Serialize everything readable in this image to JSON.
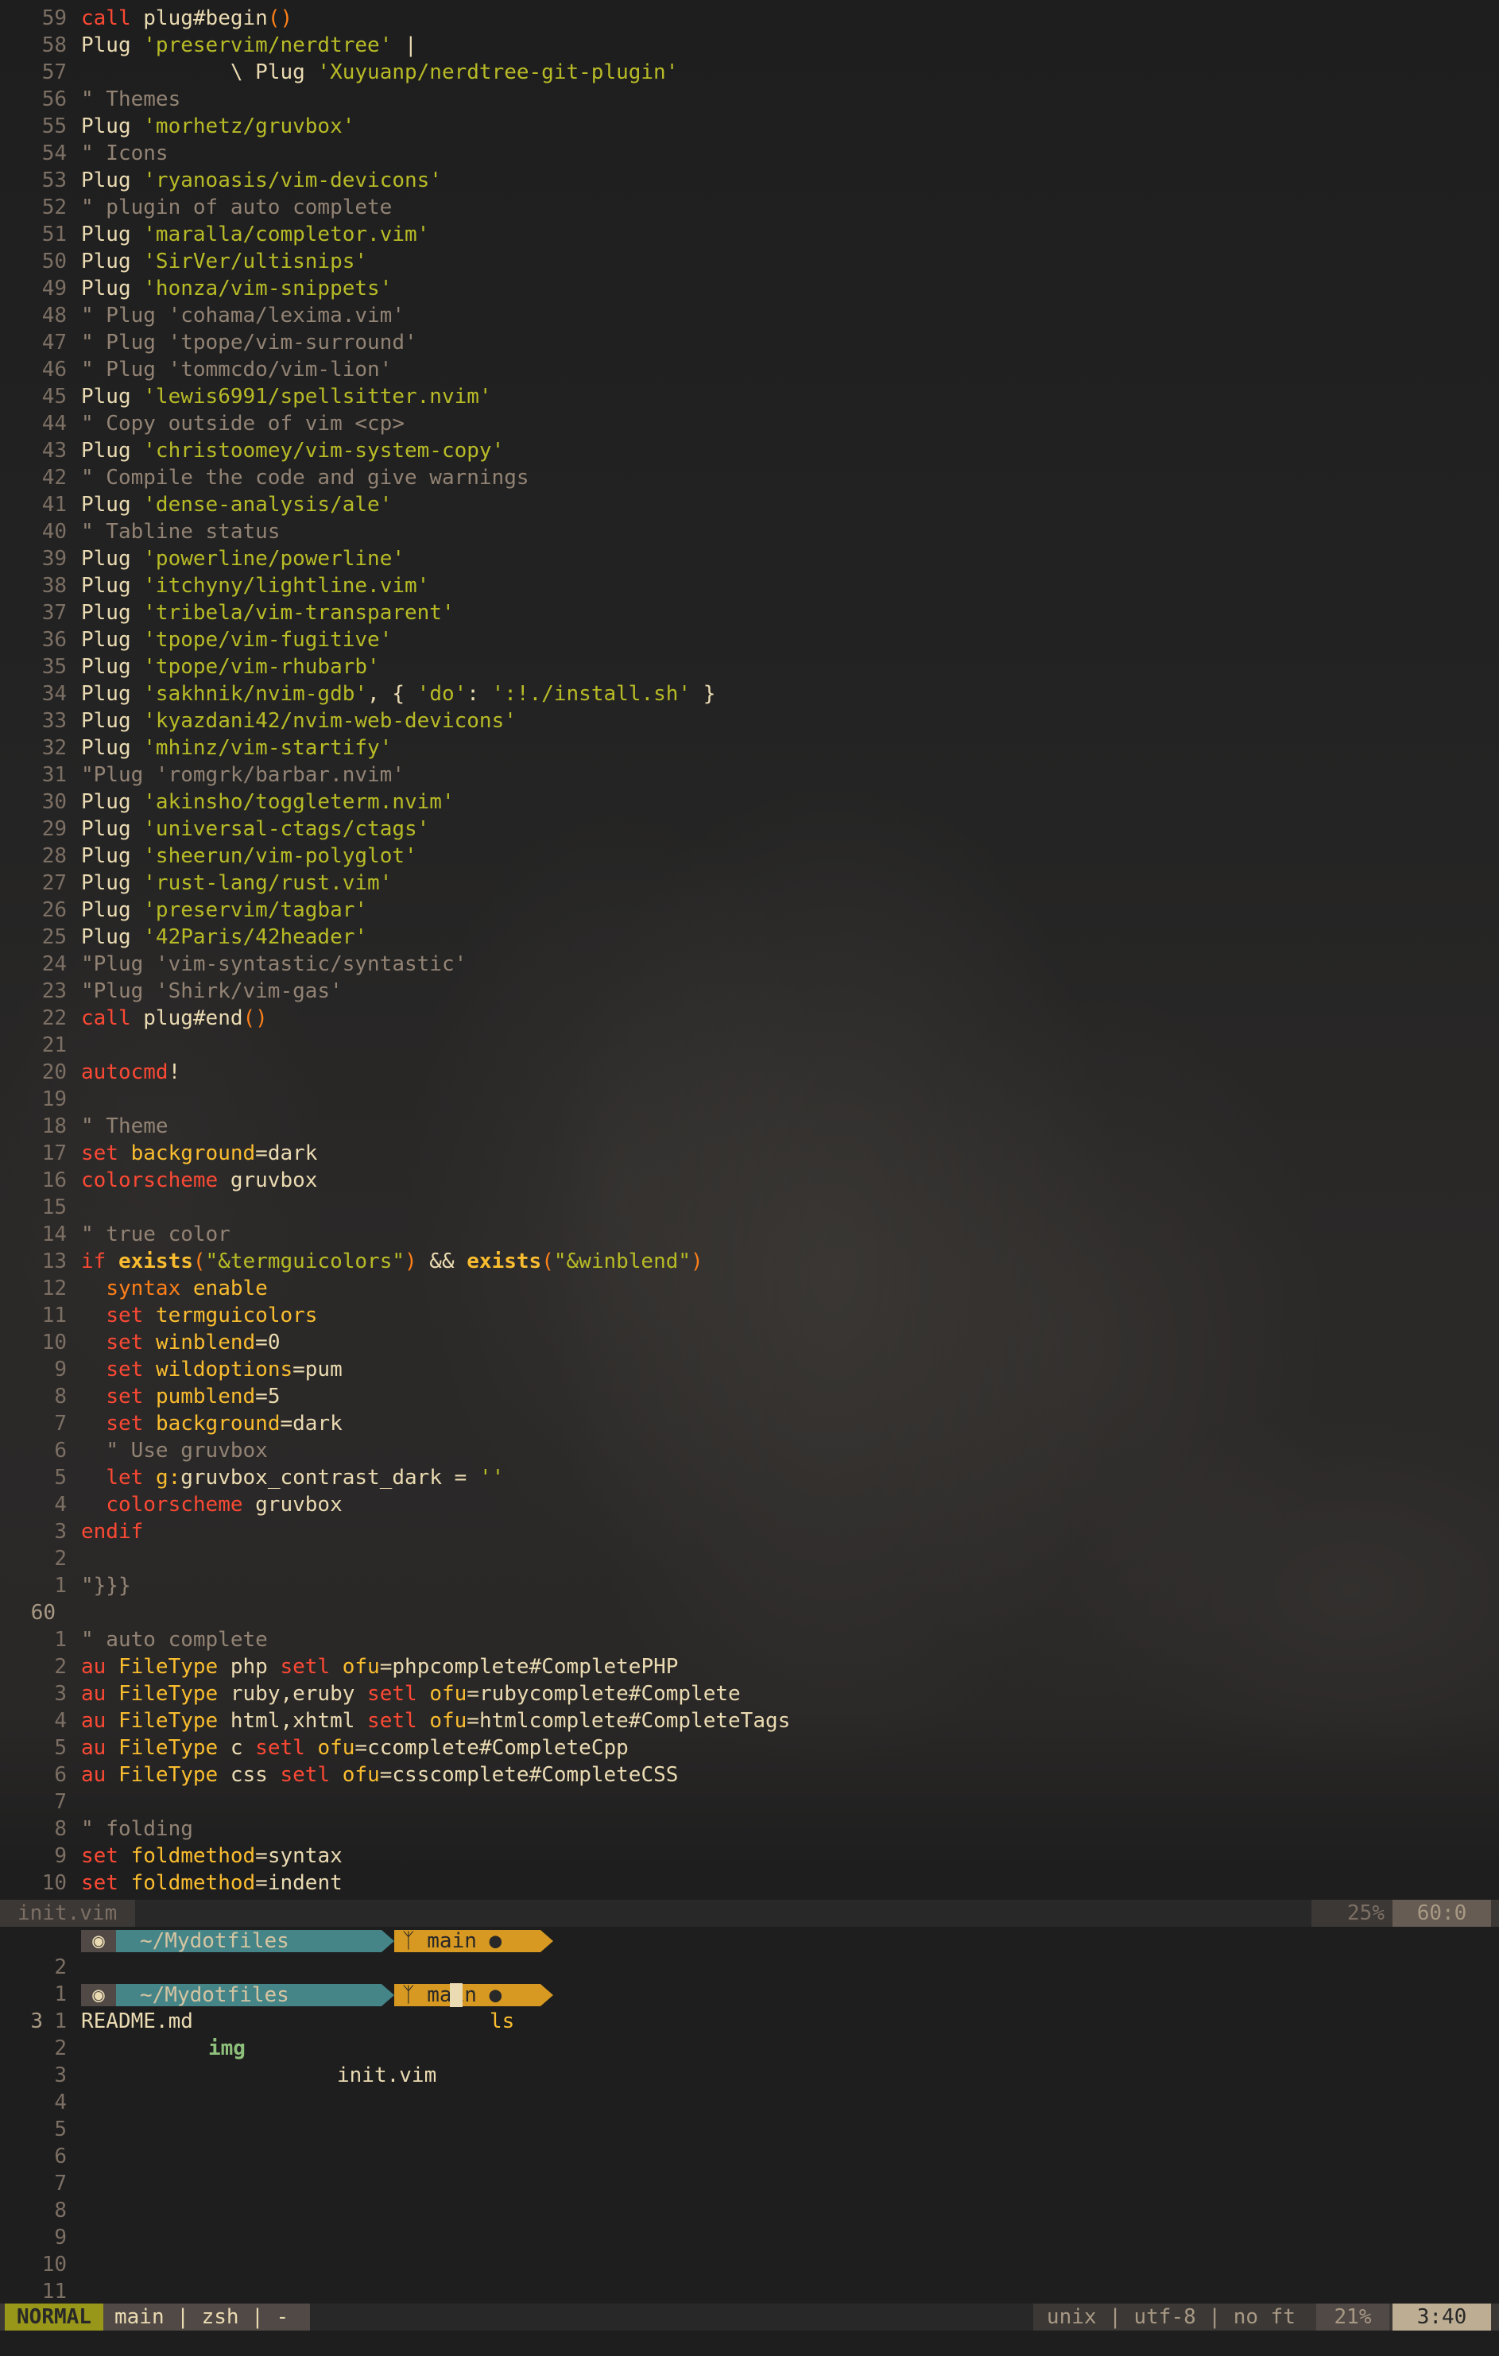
{
  "editor": {
    "lines": [
      {
        "n": "59",
        "tokens": [
          [
            "kw",
            "call"
          ],
          [
            "fg",
            " plug#begin"
          ],
          [
            "ora",
            "()"
          ]
        ]
      },
      {
        "n": "58",
        "tokens": [
          [
            "fg",
            "Plug "
          ],
          [
            "str",
            "'preservim/nerdtree'"
          ],
          [
            "fg",
            " |"
          ]
        ]
      },
      {
        "n": "57",
        "tokens": [
          [
            "fg",
            "            \\ Plug "
          ],
          [
            "str",
            "'Xuyuanp/nerdtree-git-plugin'"
          ]
        ]
      },
      {
        "n": "56",
        "tokens": [
          [
            "com",
            "\" Themes"
          ]
        ]
      },
      {
        "n": "55",
        "tokens": [
          [
            "fg",
            "Plug "
          ],
          [
            "str",
            "'morhetz/gruvbox'"
          ]
        ]
      },
      {
        "n": "54",
        "tokens": [
          [
            "com",
            "\" Icons"
          ]
        ]
      },
      {
        "n": "53",
        "tokens": [
          [
            "fg",
            "Plug "
          ],
          [
            "str",
            "'ryanoasis/vim-devicons'"
          ]
        ]
      },
      {
        "n": "52",
        "tokens": [
          [
            "com",
            "\" plugin of auto complete"
          ]
        ]
      },
      {
        "n": "51",
        "tokens": [
          [
            "fg",
            "Plug "
          ],
          [
            "str",
            "'maralla/completor.vim'"
          ]
        ]
      },
      {
        "n": "50",
        "tokens": [
          [
            "fg",
            "Plug "
          ],
          [
            "str",
            "'SirVer/ultisnips'"
          ]
        ]
      },
      {
        "n": "49",
        "tokens": [
          [
            "fg",
            "Plug "
          ],
          [
            "str",
            "'honza/vim-snippets'"
          ]
        ]
      },
      {
        "n": "48",
        "tokens": [
          [
            "com",
            "\" Plug 'cohama/lexima.vim'"
          ]
        ]
      },
      {
        "n": "47",
        "tokens": [
          [
            "com",
            "\" Plug 'tpope/vim-surround'"
          ]
        ]
      },
      {
        "n": "46",
        "tokens": [
          [
            "com",
            "\" Plug 'tommcdo/vim-lion'"
          ]
        ]
      },
      {
        "n": "45",
        "tokens": [
          [
            "fg",
            "Plug "
          ],
          [
            "str",
            "'lewis6991/spellsitter.nvim'"
          ]
        ]
      },
      {
        "n": "44",
        "tokens": [
          [
            "com",
            "\" Copy outside of vim <cp>"
          ]
        ]
      },
      {
        "n": "43",
        "tokens": [
          [
            "fg",
            "Plug "
          ],
          [
            "str",
            "'christoomey/vim-system-copy'"
          ]
        ]
      },
      {
        "n": "42",
        "tokens": [
          [
            "com",
            "\" Compile the code and give warnings"
          ]
        ]
      },
      {
        "n": "41",
        "tokens": [
          [
            "fg",
            "Plug "
          ],
          [
            "str",
            "'dense-analysis/ale'"
          ]
        ]
      },
      {
        "n": "40",
        "tokens": [
          [
            "com",
            "\" Tabline status"
          ]
        ]
      },
      {
        "n": "39",
        "tokens": [
          [
            "fg",
            "Plug "
          ],
          [
            "str",
            "'powerline/powerline'"
          ]
        ]
      },
      {
        "n": "38",
        "tokens": [
          [
            "fg",
            "Plug "
          ],
          [
            "str",
            "'itchyny/lightline.vim'"
          ]
        ]
      },
      {
        "n": "37",
        "tokens": [
          [
            "fg",
            "Plug "
          ],
          [
            "str",
            "'tribela/vim-transparent'"
          ]
        ]
      },
      {
        "n": "36",
        "tokens": [
          [
            "fg",
            "Plug "
          ],
          [
            "str",
            "'tpope/vim-fugitive'"
          ]
        ]
      },
      {
        "n": "35",
        "tokens": [
          [
            "fg",
            "Plug "
          ],
          [
            "str",
            "'tpope/vim-rhubarb'"
          ]
        ]
      },
      {
        "n": "34",
        "tokens": [
          [
            "fg",
            "Plug "
          ],
          [
            "str",
            "'sakhnik/nvim-gdb'"
          ],
          [
            "fg",
            ", { "
          ],
          [
            "str",
            "'do'"
          ],
          [
            "fg",
            ": "
          ],
          [
            "str",
            "':!./install.sh'"
          ],
          [
            "fg",
            " }"
          ]
        ]
      },
      {
        "n": "33",
        "tokens": [
          [
            "fg",
            "Plug "
          ],
          [
            "str",
            "'kyazdani42/nvim-web-devicons'"
          ]
        ]
      },
      {
        "n": "32",
        "tokens": [
          [
            "fg",
            "Plug "
          ],
          [
            "str",
            "'mhinz/vim-startify'"
          ]
        ]
      },
      {
        "n": "31",
        "tokens": [
          [
            "com",
            "\"Plug 'romgrk/barbar.nvim'"
          ]
        ]
      },
      {
        "n": "30",
        "tokens": [
          [
            "fg",
            "Plug "
          ],
          [
            "str",
            "'akinsho/toggleterm.nvim'"
          ]
        ]
      },
      {
        "n": "29",
        "tokens": [
          [
            "fg",
            "Plug "
          ],
          [
            "str",
            "'universal-ctags/ctags'"
          ]
        ]
      },
      {
        "n": "28",
        "tokens": [
          [
            "fg",
            "Plug "
          ],
          [
            "str",
            "'sheerun/vim-polyglot'"
          ]
        ]
      },
      {
        "n": "27",
        "tokens": [
          [
            "fg",
            "Plug "
          ],
          [
            "str",
            "'rust-lang/rust.vim'"
          ]
        ]
      },
      {
        "n": "26",
        "tokens": [
          [
            "fg",
            "Plug "
          ],
          [
            "str",
            "'preservim/tagbar'"
          ]
        ]
      },
      {
        "n": "25",
        "tokens": [
          [
            "fg",
            "Plug "
          ],
          [
            "str",
            "'42Paris/42header'"
          ]
        ]
      },
      {
        "n": "24",
        "tokens": [
          [
            "com",
            "\"Plug 'vim-syntastic/syntastic'"
          ]
        ]
      },
      {
        "n": "23",
        "tokens": [
          [
            "com",
            "\"Plug 'Shirk/vim-gas'"
          ]
        ]
      },
      {
        "n": "22",
        "tokens": [
          [
            "kw",
            "call"
          ],
          [
            "fg",
            " plug#end"
          ],
          [
            "ora",
            "()"
          ]
        ]
      },
      {
        "n": "21",
        "tokens": []
      },
      {
        "n": "20",
        "tokens": [
          [
            "kw",
            "autocmd"
          ],
          [
            "fg",
            "!"
          ]
        ]
      },
      {
        "n": "19",
        "tokens": []
      },
      {
        "n": "18",
        "tokens": [
          [
            "com",
            "\" Theme"
          ]
        ]
      },
      {
        "n": "17",
        "tokens": [
          [
            "kw",
            "set"
          ],
          [
            "fg",
            " "
          ],
          [
            "gold",
            "background"
          ],
          [
            "fg",
            "=dark"
          ]
        ]
      },
      {
        "n": "16",
        "tokens": [
          [
            "kw",
            "colorscheme"
          ],
          [
            "fg",
            " gruvbox"
          ]
        ]
      },
      {
        "n": "15",
        "tokens": []
      },
      {
        "n": "14",
        "tokens": [
          [
            "com",
            "\" true color"
          ]
        ]
      },
      {
        "n": "13",
        "tokens": [
          [
            "kw",
            "if"
          ],
          [
            "fg",
            " "
          ],
          [
            "bold",
            "exists"
          ],
          [
            "ora",
            "("
          ],
          [
            "str",
            "\"&termguicolors\""
          ],
          [
            "ora",
            ")"
          ],
          [
            "fg",
            " && "
          ],
          [
            "bold",
            "exists"
          ],
          [
            "ora",
            "("
          ],
          [
            "str",
            "\"&winblend\""
          ],
          [
            "ora",
            ")"
          ]
        ]
      },
      {
        "n": "12",
        "tokens": [
          [
            "fg",
            "  "
          ],
          [
            "ora",
            "syntax"
          ],
          [
            "fg",
            " "
          ],
          [
            "gold",
            "enable"
          ]
        ]
      },
      {
        "n": "11",
        "tokens": [
          [
            "fg",
            "  "
          ],
          [
            "kw",
            "set"
          ],
          [
            "fg",
            " "
          ],
          [
            "gold",
            "termguicolors"
          ]
        ]
      },
      {
        "n": "10",
        "tokens": [
          [
            "fg",
            "  "
          ],
          [
            "kw",
            "set"
          ],
          [
            "fg",
            " "
          ],
          [
            "gold",
            "winblend"
          ],
          [
            "fg",
            "=0"
          ]
        ]
      },
      {
        "n": "9",
        "tokens": [
          [
            "fg",
            "  "
          ],
          [
            "kw",
            "set"
          ],
          [
            "fg",
            " "
          ],
          [
            "gold",
            "wildoptions"
          ],
          [
            "fg",
            "=pum"
          ]
        ]
      },
      {
        "n": "8",
        "tokens": [
          [
            "fg",
            "  "
          ],
          [
            "kw",
            "set"
          ],
          [
            "fg",
            " "
          ],
          [
            "gold",
            "pumblend"
          ],
          [
            "fg",
            "=5"
          ]
        ]
      },
      {
        "n": "7",
        "tokens": [
          [
            "fg",
            "  "
          ],
          [
            "kw",
            "set"
          ],
          [
            "fg",
            " "
          ],
          [
            "gold",
            "background"
          ],
          [
            "fg",
            "=dark"
          ]
        ]
      },
      {
        "n": "6",
        "tokens": [
          [
            "fg",
            "  "
          ],
          [
            "com",
            "\" Use gruvbox"
          ]
        ]
      },
      {
        "n": "5",
        "tokens": [
          [
            "fg",
            "  "
          ],
          [
            "kw",
            "let"
          ],
          [
            "fg",
            " "
          ],
          [
            "gold",
            "g:"
          ],
          [
            "fg",
            "gruvbox_contrast_dark = "
          ],
          [
            "str",
            "''"
          ]
        ]
      },
      {
        "n": "4",
        "tokens": [
          [
            "fg",
            "  "
          ],
          [
            "kw",
            "colorscheme"
          ],
          [
            "fg",
            " gruvbox"
          ]
        ]
      },
      {
        "n": "3",
        "tokens": [
          [
            "kw",
            "endif"
          ]
        ]
      },
      {
        "n": "2",
        "tokens": []
      },
      {
        "n": "1",
        "tokens": [
          [
            "com",
            "\"}}}"
          ]
        ]
      },
      {
        "n": "60",
        "tokens": [],
        "current": true
      },
      {
        "n": "1",
        "tokens": [
          [
            "com",
            "\" auto complete"
          ]
        ]
      },
      {
        "n": "2",
        "tokens": [
          [
            "kw",
            "au"
          ],
          [
            "fg",
            " "
          ],
          [
            "gold",
            "FileType"
          ],
          [
            "fg",
            " php "
          ],
          [
            "kw",
            "setl"
          ],
          [
            "fg",
            " "
          ],
          [
            "gold",
            "ofu"
          ],
          [
            "fg",
            "=phpcomplete#CompletePHP"
          ]
        ]
      },
      {
        "n": "3",
        "tokens": [
          [
            "kw",
            "au"
          ],
          [
            "fg",
            " "
          ],
          [
            "gold",
            "FileType"
          ],
          [
            "fg",
            " ruby,eruby "
          ],
          [
            "kw",
            "setl"
          ],
          [
            "fg",
            " "
          ],
          [
            "gold",
            "ofu"
          ],
          [
            "fg",
            "=rubycomplete#Complete"
          ]
        ]
      },
      {
        "n": "4",
        "tokens": [
          [
            "kw",
            "au"
          ],
          [
            "fg",
            " "
          ],
          [
            "gold",
            "FileType"
          ],
          [
            "fg",
            " html,xhtml "
          ],
          [
            "kw",
            "setl"
          ],
          [
            "fg",
            " "
          ],
          [
            "gold",
            "ofu"
          ],
          [
            "fg",
            "=htmlcomplete#CompleteTags"
          ]
        ]
      },
      {
        "n": "5",
        "tokens": [
          [
            "kw",
            "au"
          ],
          [
            "fg",
            " "
          ],
          [
            "gold",
            "FileType"
          ],
          [
            "fg",
            " c "
          ],
          [
            "kw",
            "setl"
          ],
          [
            "fg",
            " "
          ],
          [
            "gold",
            "ofu"
          ],
          [
            "fg",
            "=ccomplete#CompleteCpp"
          ]
        ]
      },
      {
        "n": "6",
        "tokens": [
          [
            "kw",
            "au"
          ],
          [
            "fg",
            " "
          ],
          [
            "gold",
            "FileType"
          ],
          [
            "fg",
            " css "
          ],
          [
            "kw",
            "setl"
          ],
          [
            "fg",
            " "
          ],
          [
            "gold",
            "ofu"
          ],
          [
            "fg",
            "=csscomplete#CompleteCSS"
          ]
        ]
      },
      {
        "n": "7",
        "tokens": []
      },
      {
        "n": "8",
        "tokens": [
          [
            "com",
            "\" folding"
          ]
        ]
      },
      {
        "n": "9",
        "tokens": [
          [
            "kw",
            "set"
          ],
          [
            "fg",
            " "
          ],
          [
            "gold",
            "foldmethod"
          ],
          [
            "fg",
            "=syntax"
          ]
        ]
      },
      {
        "n": "10",
        "tokens": [
          [
            "kw",
            "set"
          ],
          [
            "fg",
            " "
          ],
          [
            "gold",
            "foldmethod"
          ],
          [
            "fg",
            "=indent"
          ]
        ]
      }
    ],
    "status": {
      "filename": "init.vim",
      "percent": "25%",
      "position": "60:0"
    }
  },
  "terminal": {
    "prompt_dir": "~/Mydotfiles",
    "prompt_branch": "main",
    "git_icon": "git-branch-icon",
    "apple_icon": "apple-icon",
    "dot": "●",
    "command": "ls",
    "line_nums_top": [
      "2",
      "1",
      "3"
    ],
    "ls_output": [
      {
        "name": "README.md",
        "type": "file"
      },
      {
        "name": "img",
        "type": "dir"
      },
      {
        "name": "init.vim",
        "type": "file"
      }
    ],
    "empty_line_nums": [
      "1",
      "2",
      "3",
      "4",
      "5",
      "6",
      "7",
      "8",
      "9",
      "10",
      "11"
    ]
  },
  "statusbar": {
    "mode": "NORMAL",
    "info": "main | zsh | -",
    "encoding": "unix | utf-8 | no ft",
    "percent": "21%",
    "position": "3:40"
  },
  "colors": {
    "keyword": "#fb4934",
    "string": "#b8bb26",
    "comment": "#928374",
    "accent_yellow": "#d79921",
    "accent_blue": "#458588",
    "mode_green": "#98971a"
  }
}
